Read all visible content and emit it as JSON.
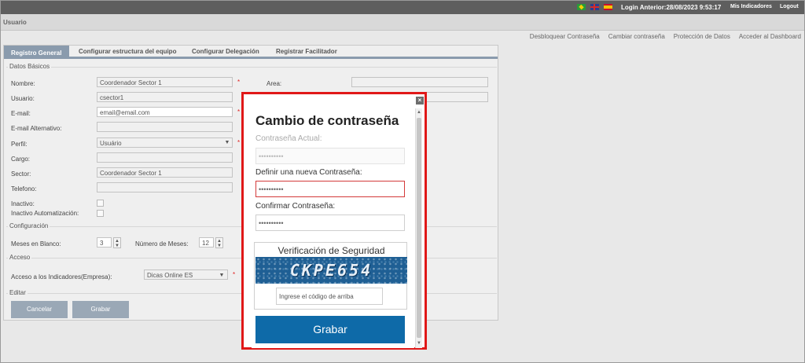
{
  "topbar": {
    "login_info": "Login Anterior:28/08/2023 9:53:17",
    "mis_indicadores": "Mis Indicadores",
    "logout": "Logout"
  },
  "module": {
    "title": "Usuario"
  },
  "actions": [
    "Desbloquear Contraseña",
    "Cambiar contraseña",
    "Protección de Datos",
    "Acceder al Dashboard"
  ],
  "tabs": [
    "Registro General",
    "Configurar estructura del equipo",
    "Configurar Delegación",
    "Registrar Facilitador"
  ],
  "sections": {
    "datos": "Datos Básicos",
    "config": "Configuración",
    "acceso": "Acceso",
    "editar": "Editar"
  },
  "form": {
    "nombre_label": "Nombre:",
    "nombre_value": "Coordenador Sector 1",
    "usuario_label": "Usuario:",
    "usuario_value": "csector1",
    "email_label": "E-mail:",
    "email_value": "email@email.com",
    "email_alt_label": "E-mail Alternativo:",
    "perfil_label": "Perfil:",
    "perfil_value": "Usuário",
    "cargo_label": "Cargo:",
    "sector_label": "Sector:",
    "sector_value": "Coordenador Sector 1",
    "telefono_label": "Telefono:",
    "inactivo_label": "Inactivo:",
    "inactivo_auto_label": "Inactivo Automatización:",
    "area_label": "Area:",
    "required_mark": "*"
  },
  "config": {
    "meses_label": "Meses en Blanco:",
    "meses_value": "3",
    "numero_label": "Número de Meses:",
    "numero_value": "12"
  },
  "acceso": {
    "label": "Acceso a los Indicadores(Empresa):",
    "value": "Dicas Online ES"
  },
  "buttons": {
    "cancelar": "Cancelar",
    "grabar": "Grabar"
  },
  "dialog": {
    "close": "×",
    "title": "Cambio de contraseña",
    "actual_label": "Contraseña Actual:",
    "actual_value": "••••••••••",
    "nueva_label": "Definir una nueva Contraseña:",
    "nueva_value": "••••••••••",
    "confirmar_label": "Confirmar Contraseña:",
    "confirmar_value": "••••••••••",
    "captcha_title": "Verificación de Seguridad",
    "captcha_code": "CKPE654",
    "captcha_placeholder": "Ingrese el código de arriba",
    "grabar": "Grabar"
  },
  "icons": {
    "dropdown": "chevron-down-icon",
    "spinner": "spinner-arrows-icon",
    "close": "close-icon"
  },
  "colors": {
    "topbar": "#5e5e5e",
    "tab_active": "#8a9bad",
    "button": "#9aa8b6",
    "dialog_button": "#0e6aa8",
    "highlight_border": "#e01818",
    "required": "#e02020"
  }
}
